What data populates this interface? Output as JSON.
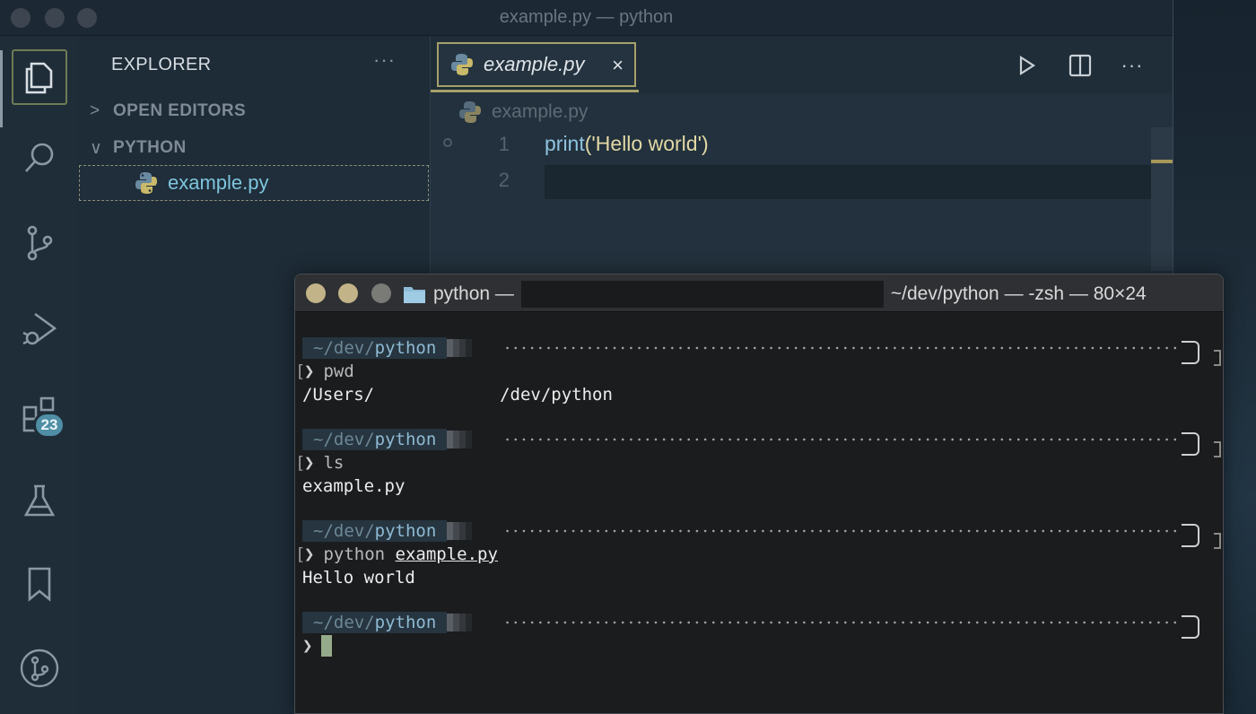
{
  "window": {
    "title": "example.py — python"
  },
  "activity_bar": {
    "items": [
      "explorer",
      "search",
      "source-control",
      "run-debug",
      "extensions",
      "testing",
      "bookmarks",
      "git-graph"
    ],
    "extensions_badge": "23"
  },
  "sidebar": {
    "title": "EXPLORER",
    "more": "···",
    "sections": [
      {
        "label": "OPEN EDITORS",
        "chevron": ">"
      },
      {
        "label": "PYTHON",
        "chevron": "∨"
      }
    ],
    "files": [
      {
        "name": "example.py",
        "icon": "python-icon"
      }
    ]
  },
  "editor": {
    "tab": {
      "label": "example.py",
      "close": "×"
    },
    "breadcrumb": "example.py",
    "line_numbers": [
      "1",
      "2"
    ],
    "code": {
      "fn": "print",
      "args": "('Hello world')"
    }
  },
  "terminal": {
    "title_left": "python —",
    "title_right": "~/dev/python — -zsh — 80×24",
    "prompt": {
      "tilde": "~/",
      "dev": "dev/",
      "dir": "python"
    },
    "blocks": [
      {
        "command": "pwd",
        "arg": "",
        "output_prefix": "/Users/",
        "output_suffix": "/dev/python"
      },
      {
        "command": "ls",
        "arg": "",
        "output": "example.py"
      },
      {
        "command": "python ",
        "arg": "example.py",
        "output": "Hello world"
      }
    ],
    "chevron": "❯",
    "bracket": "["
  },
  "colors": {
    "accent": "#a7a06a",
    "file_name": "#7ec4dd",
    "terminal_bg": "#1b1c1e"
  }
}
